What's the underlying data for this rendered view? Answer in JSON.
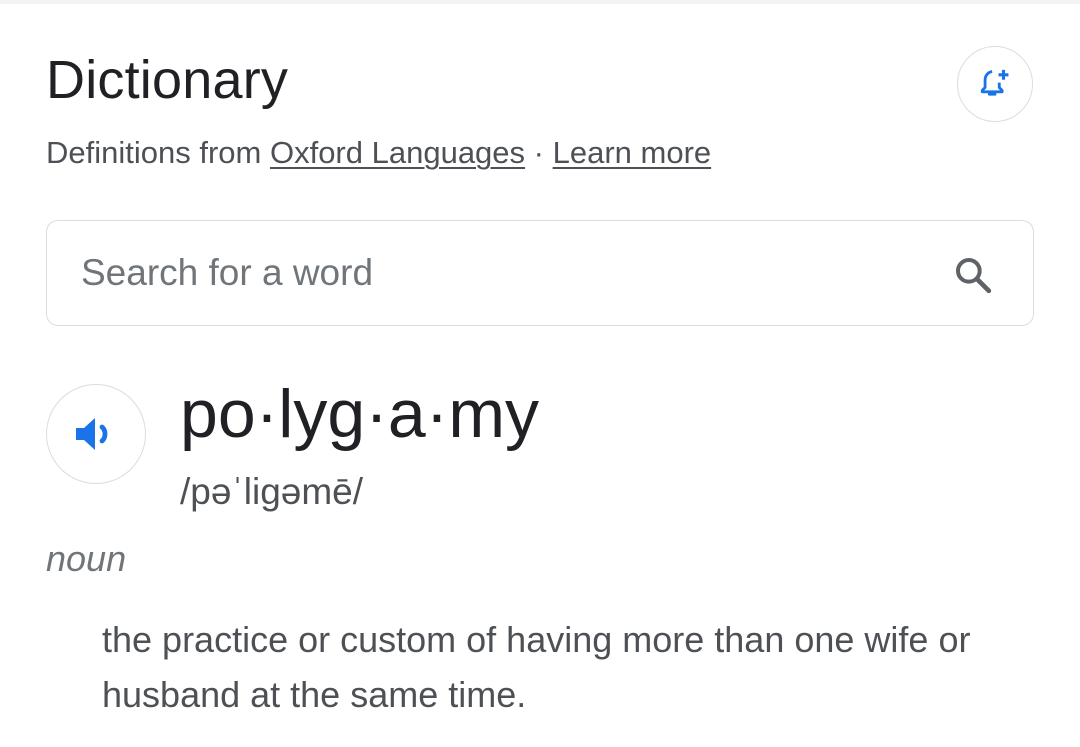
{
  "header": {
    "title": "Dictionary",
    "source_prefix": "Definitions from ",
    "source_link": "Oxford Languages",
    "separator": " · ",
    "learn_more": "Learn more",
    "alert_icon": "bell-plus-icon"
  },
  "search": {
    "placeholder": "Search for a word",
    "value": "",
    "icon": "search-icon"
  },
  "entry": {
    "speaker_icon": "speaker-icon",
    "headword": "po·lyg·a·my",
    "phonetic": "/pəˈliɡəmē/",
    "part_of_speech": "noun",
    "definition": "the practice or custom of having more than one wife or husband at the same time."
  },
  "colors": {
    "accent": "#1a73e8",
    "text_primary": "#202124",
    "text_secondary": "#4d5156",
    "text_muted": "#70757a",
    "border": "#dadce0"
  }
}
